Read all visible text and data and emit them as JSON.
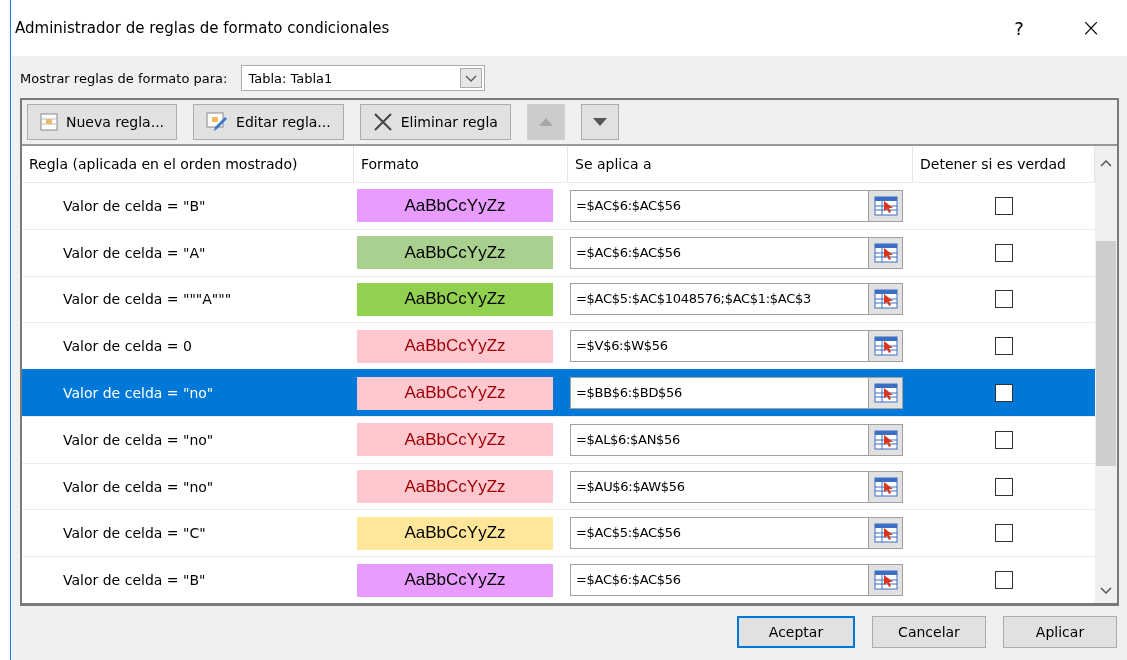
{
  "window": {
    "title": "Administrador de reglas de formato condicionales",
    "help": "?",
    "close": "×"
  },
  "show_rules": {
    "label": "Mostrar reglas de formato para:",
    "value": "Tabla: Tabla1"
  },
  "toolbar": [
    {
      "kind": "new",
      "label": "Nueva regla...",
      "disabled": false
    },
    {
      "kind": "edit",
      "label": "Editar regla...",
      "disabled": false
    },
    {
      "kind": "delete",
      "label": "Eliminar regla",
      "disabled": false
    },
    {
      "kind": "up",
      "disabled": true
    },
    {
      "kind": "down",
      "disabled": false
    }
  ],
  "table": {
    "columns": [
      "Regla (aplicada en el orden mostrado)",
      "Formato",
      "Se aplica a",
      "Detener si es verdad"
    ],
    "rows": [
      {
        "rule": "Valor de celda = \"B\"",
        "format": "AaBbCcYyZz",
        "color": "#e89cff",
        "red_text": false,
        "applies_to": "=$AC$6:$AC$56",
        "stop": false,
        "selected": false
      },
      {
        "rule": "Valor de celda = \"A\"",
        "format": "AaBbCcYyZz",
        "color": "#a9d08e",
        "red_text": false,
        "applies_to": "=$AC$6:$AC$56",
        "stop": false,
        "selected": false
      },
      {
        "rule": "Valor de celda = \"\"\"A\"\"\"",
        "format": "AaBbCcYyZz",
        "color": "#92d050",
        "red_text": false,
        "applies_to": "=$AC$5:$AC$1048576;$AC$1:$AC$3",
        "stop": false,
        "selected": false
      },
      {
        "rule": "Valor de celda = 0",
        "format": "AaBbCcYyZz",
        "color": "#ffc7ce",
        "red_text": true,
        "applies_to": "=$V$6:$W$56",
        "stop": false,
        "selected": false
      },
      {
        "rule": "Valor de celda = \"no\"",
        "format": "AaBbCcYyZz",
        "color": "#ffc7ce",
        "red_text": true,
        "applies_to": "=$BB$6:$BD$56",
        "stop": false,
        "selected": true
      },
      {
        "rule": "Valor de celda = \"no\"",
        "format": "AaBbCcYyZz",
        "color": "#ffc7ce",
        "red_text": true,
        "applies_to": "=$AL$6:$AN$56",
        "stop": false,
        "selected": false
      },
      {
        "rule": "Valor de celda = \"no\"",
        "format": "AaBbCcYyZz",
        "color": "#ffc7ce",
        "red_text": true,
        "applies_to": "=$AU$6:$AW$56",
        "stop": false,
        "selected": false
      },
      {
        "rule": "Valor de celda = \"C\"",
        "format": "AaBbCcYyZz",
        "color": "#ffe699",
        "red_text": false,
        "applies_to": "=$AC$5:$AC$56",
        "stop": false,
        "selected": false
      },
      {
        "rule": "Valor de celda = \"B\"",
        "format": "AaBbCcYyZz",
        "color": "#e89cff",
        "red_text": false,
        "applies_to": "=$AC$6:$AC$56",
        "stop": false,
        "selected": false
      }
    ]
  },
  "buttons": [
    {
      "label": "Aceptar",
      "default": true
    },
    {
      "label": "Cancelar",
      "default": false
    },
    {
      "label": "Aplicar",
      "default": false
    }
  ]
}
